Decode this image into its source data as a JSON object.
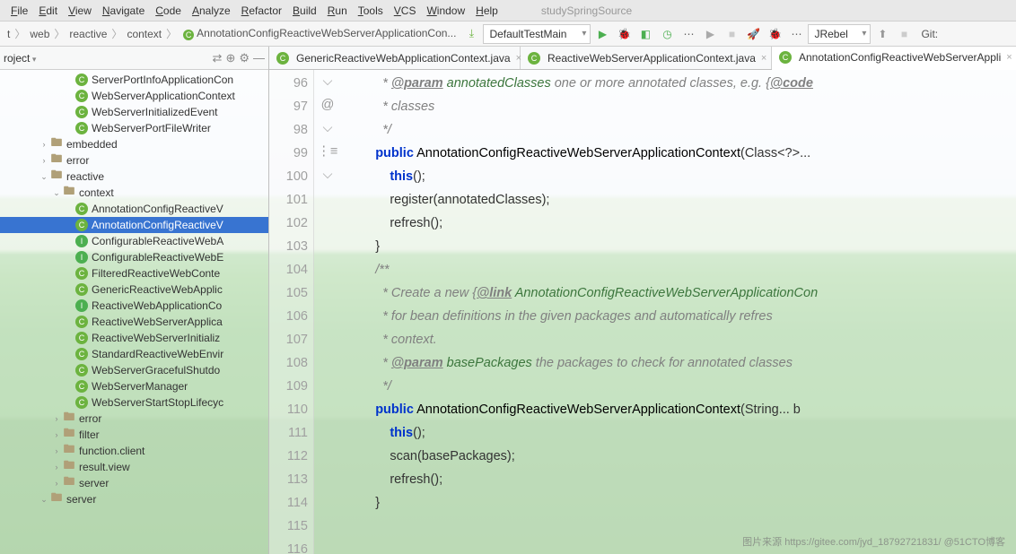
{
  "menu": {
    "items": [
      "File",
      "Edit",
      "View",
      "Navigate",
      "Code",
      "Analyze",
      "Refactor",
      "Build",
      "Run",
      "Tools",
      "VCS",
      "Window",
      "Help"
    ],
    "project": "studySpringSource"
  },
  "breadcrumbs": {
    "items": [
      "t",
      "web",
      "reactive",
      "context"
    ],
    "cls": "AnnotationConfigReactiveWebServerApplicationCon..."
  },
  "runconfig": "DefaultTestMain",
  "jrebel": "JRebel",
  "git": "Git:",
  "sidebar": {
    "title": "roject",
    "top": [
      {
        "icon": "c",
        "label": "ServerPortInfoApplicationCon",
        "ind": 5,
        "sel": false
      },
      {
        "icon": "c",
        "label": "WebServerApplicationContext",
        "ind": 5,
        "sel": false
      },
      {
        "icon": "c",
        "label": "WebServerInitializedEvent",
        "ind": 5,
        "sel": false
      },
      {
        "icon": "c",
        "label": "WebServerPortFileWriter",
        "ind": 5,
        "sel": false
      }
    ],
    "folders": [
      {
        "label": "embedded",
        "ind": 3,
        "open": false,
        "arrow": ">"
      },
      {
        "label": "error",
        "ind": 3,
        "open": false,
        "arrow": ">"
      },
      {
        "label": "reactive",
        "ind": 3,
        "open": true,
        "arrow": "v"
      },
      {
        "label": "context",
        "ind": 4,
        "open": true,
        "arrow": "v"
      }
    ],
    "ctx": [
      {
        "icon": "c",
        "label": "AnnotationConfigReactiveV",
        "sel": false
      },
      {
        "icon": "c",
        "label": "AnnotationConfigReactiveV",
        "sel": true
      },
      {
        "icon": "i",
        "label": "ConfigurableReactiveWebA",
        "sel": false
      },
      {
        "icon": "i",
        "label": "ConfigurableReactiveWebE",
        "sel": false
      },
      {
        "icon": "c",
        "label": "FilteredReactiveWebConte",
        "sel": false
      },
      {
        "icon": "c",
        "label": "GenericReactiveWebApplic",
        "sel": false
      },
      {
        "icon": "i",
        "label": "ReactiveWebApplicationCo",
        "sel": false
      },
      {
        "icon": "c",
        "label": "ReactiveWebServerApplica",
        "sel": false
      },
      {
        "icon": "c",
        "label": "ReactiveWebServerInitializ",
        "sel": false
      },
      {
        "icon": "c",
        "label": "StandardReactiveWebEnvir",
        "sel": false
      },
      {
        "icon": "c",
        "label": "WebServerGracefulShutdo",
        "sel": false
      },
      {
        "icon": "c",
        "label": "WebServerManager",
        "sel": false
      },
      {
        "icon": "c",
        "label": "WebServerStartStopLifecyc",
        "sel": false
      }
    ],
    "bottom": [
      {
        "label": "error",
        "ind": 4,
        "arrow": ">"
      },
      {
        "label": "filter",
        "ind": 4,
        "arrow": ">"
      },
      {
        "label": "function.client",
        "ind": 4,
        "arrow": ">"
      },
      {
        "label": "result.view",
        "ind": 4,
        "arrow": ">"
      },
      {
        "label": "server",
        "ind": 4,
        "arrow": ">"
      },
      {
        "label": "server",
        "ind": 3,
        "arrow": "v"
      }
    ]
  },
  "tabs": [
    {
      "label": "GenericReactiveWebApplicationContext.java",
      "active": false
    },
    {
      "label": "ReactiveWebServerApplicationContext.java",
      "active": false
    },
    {
      "label": "AnnotationConfigReactiveWebServerAppli",
      "active": true
    }
  ],
  "code": {
    "start": 96,
    "lines": [
      {
        "n": 96,
        "ic": "",
        "html": "        <span class='cm'> * <span class='tag'>@param</span> <span class='cmp'>annotatedClasses</span> one or more annotated classes, e.g. {<span class='tag'>@code</span></span>"
      },
      {
        "n": 97,
        "ic": "",
        "html": "        <span class='cm'> * classes</span>"
      },
      {
        "n": 98,
        "ic": "⌵",
        "html": "        <span class='cm'> */</span>"
      },
      {
        "n": 99,
        "ic": "@",
        "html": "       <span class='kw'>public</span> <span class='mth'>AnnotationConfigReactiveWebServerApplicationContext</span>(Class&lt;?&gt;..."
      },
      {
        "n": 100,
        "ic": "",
        "html": "           <span class='kw'>this</span>();"
      },
      {
        "n": 101,
        "ic": "",
        "html": "           register(annotatedClasses);"
      },
      {
        "n": 102,
        "ic": "",
        "html": "           refresh();"
      },
      {
        "n": 103,
        "ic": "⌵",
        "html": "       }"
      },
      {
        "n": 104,
        "ic": "",
        "html": ""
      },
      {
        "n": 105,
        "ic": "⋮≡",
        "html": "       <span class='cm'>/**</span>"
      },
      {
        "n": 106,
        "ic": "",
        "html": "        <span class='cm'> * Create a new {<span class='tag'>@link</span> <span class='cmp'>AnnotationConfigReactiveWebServerApplicationCon</span></span>"
      },
      {
        "n": 107,
        "ic": "",
        "html": "        <span class='cm'> * for bean definitions in the given packages and automatically refres</span>"
      },
      {
        "n": 108,
        "ic": "",
        "html": "        <span class='cm'> * context.</span>"
      },
      {
        "n": 109,
        "ic": "",
        "html": "        <span class='cm'> * <span class='tag'>@param</span> <span class='cmp'>basePackages</span> the packages to check for annotated classes</span>"
      },
      {
        "n": 110,
        "ic": "",
        "html": "        <span class='cm'> */</span>"
      },
      {
        "n": 111,
        "ic": "",
        "html": "       <span class='kw'>public</span> <span class='mth'>AnnotationConfigReactiveWebServerApplicationContext</span>(String... b"
      },
      {
        "n": 112,
        "ic": "",
        "html": "           <span class='kw'>this</span>();"
      },
      {
        "n": 113,
        "ic": "",
        "html": "           scan(basePackages);"
      },
      {
        "n": 114,
        "ic": "",
        "html": "           refresh();"
      },
      {
        "n": 115,
        "ic": "⌵",
        "html": "       }"
      },
      {
        "n": 116,
        "ic": "",
        "html": ""
      }
    ]
  },
  "watermark": "图片来源 https://gitee.com/jyd_18792721831/    @51CTO博客"
}
